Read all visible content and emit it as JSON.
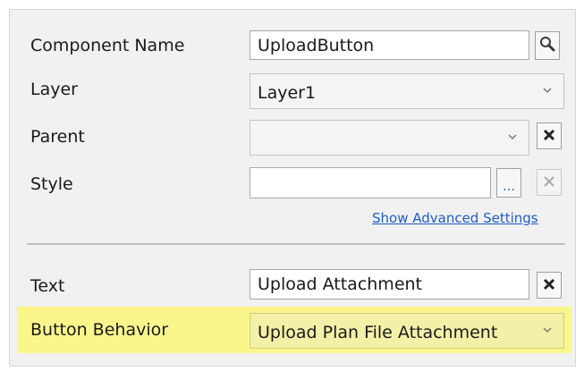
{
  "properties": {
    "component_name": {
      "label": "Component Name",
      "value": "UploadButton"
    },
    "layer": {
      "label": "Layer",
      "value": "Layer1"
    },
    "parent": {
      "label": "Parent",
      "value": ""
    },
    "style": {
      "label": "Style",
      "value": "",
      "browse_label": "..."
    },
    "advanced_link": "Show Advanced Settings",
    "text": {
      "label": "Text",
      "value": "Upload Attachment"
    },
    "button_behavior": {
      "label": "Button Behavior",
      "value": "Upload Plan File Attachment"
    }
  },
  "highlight_color": "#faf68b",
  "icons": [
    "search-icon",
    "chevron-down-icon",
    "clear-x-icon"
  ]
}
